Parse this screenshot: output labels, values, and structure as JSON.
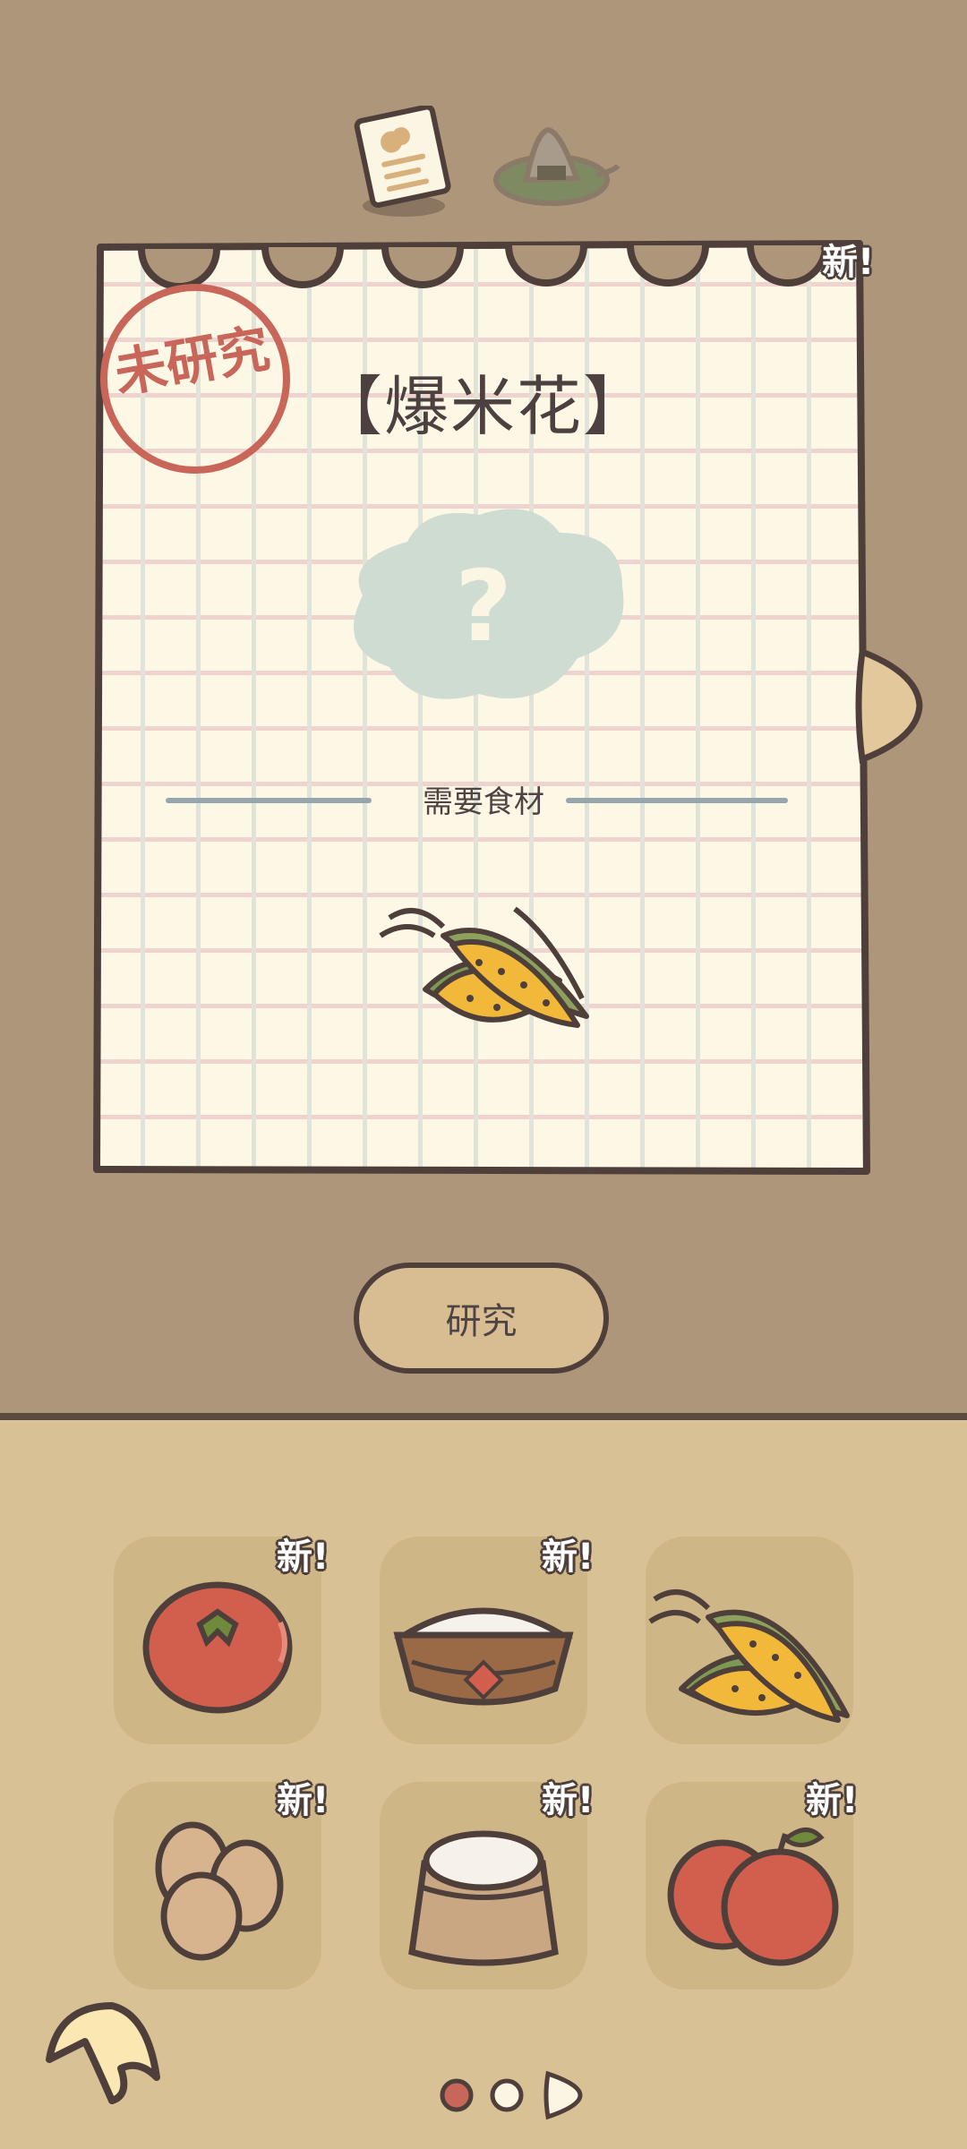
{
  "recipe": {
    "title": "【爆米花】",
    "stamp_text": "未研究",
    "ingredients_label": "需要食材",
    "ingredient_icon": "corn-icon",
    "new_badge": "新!"
  },
  "tabs": [
    {
      "name": "recipe-tab",
      "icon": "recipe-card-icon"
    },
    {
      "name": "food-tab",
      "icon": "rice-ball-icon"
    }
  ],
  "actions": {
    "research_label": "研究"
  },
  "ingredients": [
    {
      "icon": "tomato-icon",
      "badge": "新!"
    },
    {
      "icon": "rice-bowl-icon",
      "badge": "新!"
    },
    {
      "icon": "corn-icon",
      "badge": ""
    },
    {
      "icon": "eggs-icon",
      "badge": "新!"
    },
    {
      "icon": "flour-sack-icon",
      "badge": "新!"
    },
    {
      "icon": "apples-icon",
      "badge": "新!"
    }
  ],
  "pagination": {
    "pages": 3,
    "current": 2
  },
  "colors": {
    "background_top": "#ae967a",
    "background_bottom": "#d8c195",
    "outline": "#4e3f3b",
    "paper": "#fdf8e6",
    "stamp": "#c8665a"
  }
}
